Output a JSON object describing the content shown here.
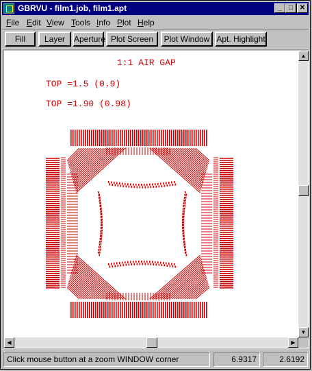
{
  "window": {
    "title": "GBRVU - film1.job, film1.apt",
    "controls": {
      "minimize": "_",
      "maximize": "□",
      "close": "✕"
    }
  },
  "menu": [
    {
      "label": "File",
      "ul": "F",
      "rest": "ile"
    },
    {
      "label": "Edit",
      "ul": "E",
      "rest": "dit"
    },
    {
      "label": "View",
      "ul": "V",
      "rest": "iew"
    },
    {
      "label": "Tools",
      "ul": "T",
      "rest": "ools"
    },
    {
      "label": "Info",
      "ul": "I",
      "rest": "nfo"
    },
    {
      "label": "Plot",
      "ul": "P",
      "rest": "lot"
    },
    {
      "label": "Help",
      "ul": "H",
      "rest": "elp"
    }
  ],
  "toolbar": {
    "fill": "Fill",
    "layer": "Layer",
    "aperture": "Aperture",
    "plot_screen": "Plot Screen",
    "plot_window": "Plot Window",
    "apt_highlight": "Apt. Highlight"
  },
  "drawing": {
    "color": "#d00000",
    "heading": "1:1 AIR GAP",
    "note1": "TOP =1.5 (0.9)",
    "note2": "TOP =1.90 (0.98)"
  },
  "status": {
    "message": "Click mouse button at a zoom WINDOW corner",
    "x": "6.9317",
    "y": "2.6192"
  }
}
